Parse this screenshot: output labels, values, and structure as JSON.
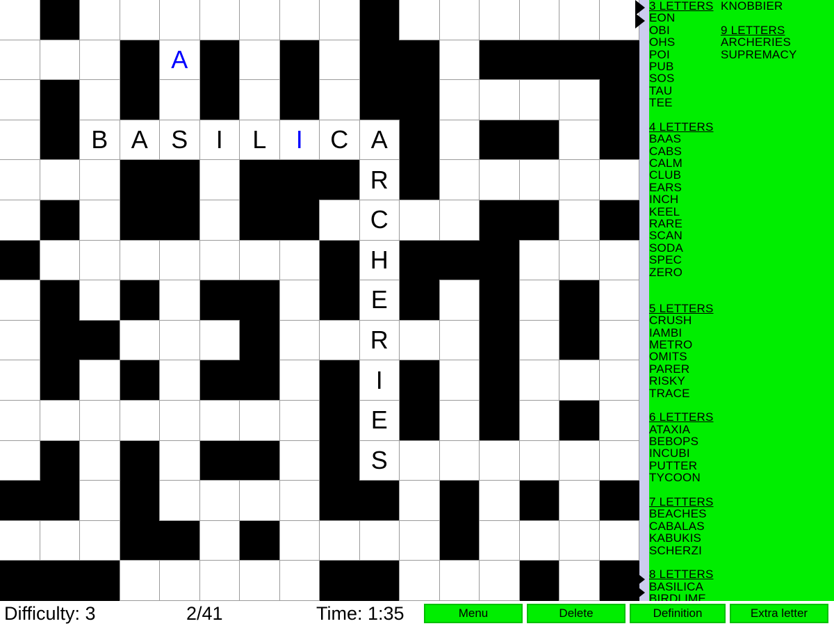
{
  "grid": {
    "rows": 15,
    "cols": 16,
    "block_color": "#000000",
    "cell_color": "#ffffff",
    "highlight_color": "#0000ff",
    "cells": [
      [
        {
          "t": "w"
        },
        {
          "t": "b"
        },
        {
          "t": "w"
        },
        {
          "t": "w"
        },
        {
          "t": "w"
        },
        {
          "t": "w"
        },
        {
          "t": "w"
        },
        {
          "t": "w"
        },
        {
          "t": "w"
        },
        {
          "t": "b"
        },
        {
          "t": "w"
        },
        {
          "t": "w"
        },
        {
          "t": "w"
        },
        {
          "t": "w"
        },
        {
          "t": "w"
        },
        {
          "t": "w"
        }
      ],
      [
        {
          "t": "w"
        },
        {
          "t": "w"
        },
        {
          "t": "w"
        },
        {
          "t": "b"
        },
        {
          "t": "w",
          "l": "A",
          "hl": true
        },
        {
          "t": "b"
        },
        {
          "t": "w"
        },
        {
          "t": "b"
        },
        {
          "t": "w"
        },
        {
          "t": "b"
        },
        {
          "t": "b"
        },
        {
          "t": "w"
        },
        {
          "t": "b"
        },
        {
          "t": "b"
        },
        {
          "t": "b"
        },
        {
          "t": "b"
        }
      ],
      [
        {
          "t": "w"
        },
        {
          "t": "b"
        },
        {
          "t": "w"
        },
        {
          "t": "b"
        },
        {
          "t": "w"
        },
        {
          "t": "b"
        },
        {
          "t": "w"
        },
        {
          "t": "b"
        },
        {
          "t": "w"
        },
        {
          "t": "b"
        },
        {
          "t": "b"
        },
        {
          "t": "w"
        },
        {
          "t": "w"
        },
        {
          "t": "w"
        },
        {
          "t": "w"
        },
        {
          "t": "b"
        }
      ],
      [
        {
          "t": "w"
        },
        {
          "t": "b"
        },
        {
          "t": "w",
          "l": "B"
        },
        {
          "t": "w",
          "l": "A"
        },
        {
          "t": "w",
          "l": "S"
        },
        {
          "t": "w",
          "l": "I"
        },
        {
          "t": "w",
          "l": "L"
        },
        {
          "t": "w",
          "l": "I",
          "hl": true
        },
        {
          "t": "w",
          "l": "C"
        },
        {
          "t": "w",
          "l": "A"
        },
        {
          "t": "b"
        },
        {
          "t": "w"
        },
        {
          "t": "b"
        },
        {
          "t": "b"
        },
        {
          "t": "w"
        },
        {
          "t": "b"
        }
      ],
      [
        {
          "t": "w"
        },
        {
          "t": "w"
        },
        {
          "t": "w"
        },
        {
          "t": "b"
        },
        {
          "t": "b"
        },
        {
          "t": "w"
        },
        {
          "t": "b"
        },
        {
          "t": "b"
        },
        {
          "t": "b"
        },
        {
          "t": "w",
          "l": "R"
        },
        {
          "t": "b"
        },
        {
          "t": "w"
        },
        {
          "t": "w"
        },
        {
          "t": "w"
        },
        {
          "t": "w"
        },
        {
          "t": "w"
        }
      ],
      [
        {
          "t": "w"
        },
        {
          "t": "b"
        },
        {
          "t": "w"
        },
        {
          "t": "b"
        },
        {
          "t": "b"
        },
        {
          "t": "w"
        },
        {
          "t": "b"
        },
        {
          "t": "b"
        },
        {
          "t": "w"
        },
        {
          "t": "w",
          "l": "C"
        },
        {
          "t": "w"
        },
        {
          "t": "w"
        },
        {
          "t": "b"
        },
        {
          "t": "b"
        },
        {
          "t": "w"
        },
        {
          "t": "b"
        }
      ],
      [
        {
          "t": "b"
        },
        {
          "t": "w"
        },
        {
          "t": "w"
        },
        {
          "t": "w"
        },
        {
          "t": "w"
        },
        {
          "t": "w"
        },
        {
          "t": "w"
        },
        {
          "t": "w"
        },
        {
          "t": "b"
        },
        {
          "t": "w",
          "l": "H"
        },
        {
          "t": "b"
        },
        {
          "t": "b"
        },
        {
          "t": "b"
        },
        {
          "t": "w"
        },
        {
          "t": "w"
        },
        {
          "t": "w"
        }
      ],
      [
        {
          "t": "w"
        },
        {
          "t": "b"
        },
        {
          "t": "w"
        },
        {
          "t": "b"
        },
        {
          "t": "w"
        },
        {
          "t": "b"
        },
        {
          "t": "b"
        },
        {
          "t": "w"
        },
        {
          "t": "b"
        },
        {
          "t": "w",
          "l": "E"
        },
        {
          "t": "b"
        },
        {
          "t": "w"
        },
        {
          "t": "b"
        },
        {
          "t": "w"
        },
        {
          "t": "b"
        },
        {
          "t": "w"
        }
      ],
      [
        {
          "t": "w"
        },
        {
          "t": "b"
        },
        {
          "t": "b"
        },
        {
          "t": "w"
        },
        {
          "t": "w"
        },
        {
          "t": "w"
        },
        {
          "t": "b"
        },
        {
          "t": "w"
        },
        {
          "t": "w"
        },
        {
          "t": "w",
          "l": "R"
        },
        {
          "t": "w"
        },
        {
          "t": "w"
        },
        {
          "t": "b"
        },
        {
          "t": "w"
        },
        {
          "t": "b"
        },
        {
          "t": "w"
        }
      ],
      [
        {
          "t": "w"
        },
        {
          "t": "b"
        },
        {
          "t": "w"
        },
        {
          "t": "b"
        },
        {
          "t": "w"
        },
        {
          "t": "b"
        },
        {
          "t": "b"
        },
        {
          "t": "w"
        },
        {
          "t": "b"
        },
        {
          "t": "w",
          "l": "I"
        },
        {
          "t": "b"
        },
        {
          "t": "w"
        },
        {
          "t": "b"
        },
        {
          "t": "w"
        },
        {
          "t": "w"
        },
        {
          "t": "w"
        }
      ],
      [
        {
          "t": "w"
        },
        {
          "t": "w"
        },
        {
          "t": "w"
        },
        {
          "t": "w"
        },
        {
          "t": "w"
        },
        {
          "t": "w"
        },
        {
          "t": "w"
        },
        {
          "t": "w"
        },
        {
          "t": "b"
        },
        {
          "t": "w",
          "l": "E"
        },
        {
          "t": "b"
        },
        {
          "t": "w"
        },
        {
          "t": "b"
        },
        {
          "t": "w"
        },
        {
          "t": "b"
        },
        {
          "t": "w"
        }
      ],
      [
        {
          "t": "w"
        },
        {
          "t": "b"
        },
        {
          "t": "w"
        },
        {
          "t": "b"
        },
        {
          "t": "w"
        },
        {
          "t": "b"
        },
        {
          "t": "b"
        },
        {
          "t": "w"
        },
        {
          "t": "b"
        },
        {
          "t": "w",
          "l": "S"
        },
        {
          "t": "w"
        },
        {
          "t": "w"
        },
        {
          "t": "w"
        },
        {
          "t": "w"
        },
        {
          "t": "w"
        },
        {
          "t": "w"
        }
      ],
      [
        {
          "t": "b"
        },
        {
          "t": "b"
        },
        {
          "t": "w"
        },
        {
          "t": "b"
        },
        {
          "t": "w"
        },
        {
          "t": "w"
        },
        {
          "t": "w"
        },
        {
          "t": "w"
        },
        {
          "t": "b"
        },
        {
          "t": "b"
        },
        {
          "t": "w"
        },
        {
          "t": "b"
        },
        {
          "t": "w"
        },
        {
          "t": "b"
        },
        {
          "t": "w"
        },
        {
          "t": "b"
        }
      ],
      [
        {
          "t": "w"
        },
        {
          "t": "w"
        },
        {
          "t": "w"
        },
        {
          "t": "b"
        },
        {
          "t": "b"
        },
        {
          "t": "w"
        },
        {
          "t": "b"
        },
        {
          "t": "w"
        },
        {
          "t": "w"
        },
        {
          "t": "w"
        },
        {
          "t": "w"
        },
        {
          "t": "b"
        },
        {
          "t": "w"
        },
        {
          "t": "w"
        },
        {
          "t": "w"
        },
        {
          "t": "w"
        }
      ],
      [
        {
          "t": "b"
        },
        {
          "t": "b"
        },
        {
          "t": "b"
        },
        {
          "t": "w"
        },
        {
          "t": "w"
        },
        {
          "t": "w"
        },
        {
          "t": "w"
        },
        {
          "t": "w"
        },
        {
          "t": "b"
        },
        {
          "t": "b"
        },
        {
          "t": "w"
        },
        {
          "t": "w"
        },
        {
          "t": "w"
        },
        {
          "t": "b"
        },
        {
          "t": "w"
        },
        {
          "t": "b"
        }
      ]
    ]
  },
  "scrollbar": {
    "track_color": "#ccccee",
    "arrow_up_icon": "triangle-left-icon",
    "arrow_down_icon": "triangle-left-icon"
  },
  "wordlist": {
    "background_color": "#00ee00",
    "column1": [
      {
        "text": "3 LETTERS",
        "head": true
      },
      {
        "text": "EON"
      },
      {
        "text": "OBI"
      },
      {
        "text": "OHS"
      },
      {
        "text": "POI"
      },
      {
        "text": "PUB"
      },
      {
        "text": "SOS"
      },
      {
        "text": "TAU"
      },
      {
        "text": "TEE"
      },
      {
        "text": "",
        "blank": true
      },
      {
        "text": "4 LETTERS",
        "head": true
      },
      {
        "text": "BAAS"
      },
      {
        "text": "CABS"
      },
      {
        "text": "CALM"
      },
      {
        "text": "CLUB"
      },
      {
        "text": "EARS"
      },
      {
        "text": "INCH"
      },
      {
        "text": "KEEL"
      },
      {
        "text": "RARE"
      },
      {
        "text": "SCAN"
      },
      {
        "text": "SODA"
      },
      {
        "text": "SPEC"
      },
      {
        "text": "ZERO"
      },
      {
        "text": "",
        "blank": true
      },
      {
        "text": "",
        "blank": true
      },
      {
        "text": "5 LETTERS",
        "head": true
      },
      {
        "text": "CRUSH"
      },
      {
        "text": "IAMBI"
      },
      {
        "text": "METRO"
      },
      {
        "text": "OMITS"
      },
      {
        "text": "PARER"
      },
      {
        "text": "RISKY"
      },
      {
        "text": "TRACE"
      },
      {
        "text": "",
        "blank": true
      },
      {
        "text": "6 LETTERS",
        "head": true
      },
      {
        "text": "ATAXIA"
      },
      {
        "text": "BEBOPS"
      },
      {
        "text": "INCUBI"
      },
      {
        "text": "PUTTER"
      },
      {
        "text": "TYCOON"
      },
      {
        "text": "",
        "blank": true
      },
      {
        "text": "7 LETTERS",
        "head": true
      },
      {
        "text": "BEACHES"
      },
      {
        "text": "CABALAS"
      },
      {
        "text": "KABUKIS"
      },
      {
        "text": "SCHERZI"
      },
      {
        "text": "",
        "blank": true
      },
      {
        "text": "8 LETTERS",
        "head": true
      },
      {
        "text": "BASILICA"
      },
      {
        "text": "BIRDLIME"
      }
    ],
    "column2": [
      {
        "text": "KNOBBIER"
      },
      {
        "text": "",
        "blank": true
      },
      {
        "text": "9 LETTERS",
        "head": true
      },
      {
        "text": "ARCHERIES"
      },
      {
        "text": "SUPREMACY"
      }
    ]
  },
  "bottombar": {
    "difficulty": "Difficulty: 3",
    "progress": "2/41",
    "time": "Time: 1:35",
    "buttons": {
      "menu": "Menu",
      "delete": "Delete",
      "definition": "Definition",
      "extra_letter": "Extra letter"
    },
    "button_color": "#00ee00"
  }
}
